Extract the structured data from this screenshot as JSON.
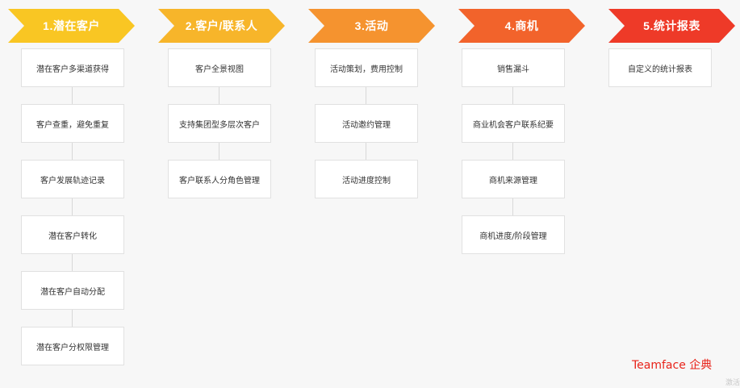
{
  "stages": [
    {
      "label": "1.潜在客户",
      "color": "#f9c623",
      "items": [
        "潜在客户多渠道获得",
        "客户查重，避免重复",
        "客户发展轨迹记录",
        "潜在客户转化",
        "潜在客户自动分配",
        "潜在客户分权限管理"
      ]
    },
    {
      "label": "2.客户/联系人",
      "color": "#f7b52a",
      "items": [
        "客户全景视图",
        "支持集团型多层次客户",
        "客户联系人分角色管理"
      ]
    },
    {
      "label": "3.活动",
      "color": "#f5932f",
      "items": [
        "活动策划，费用控制",
        "活动邀约管理",
        "活动进度控制"
      ]
    },
    {
      "label": "4.商机",
      "color": "#f2632b",
      "items": [
        "销售漏斗",
        "商业机会客户联系纪要",
        "商机来源管理",
        "商机进度/阶段管理"
      ]
    },
    {
      "label": "5.统计报表",
      "color": "#ee3a28",
      "items": [
        "自定义的统计报表"
      ]
    }
  ],
  "brand": "Teamface 企典",
  "watermark": "激活"
}
